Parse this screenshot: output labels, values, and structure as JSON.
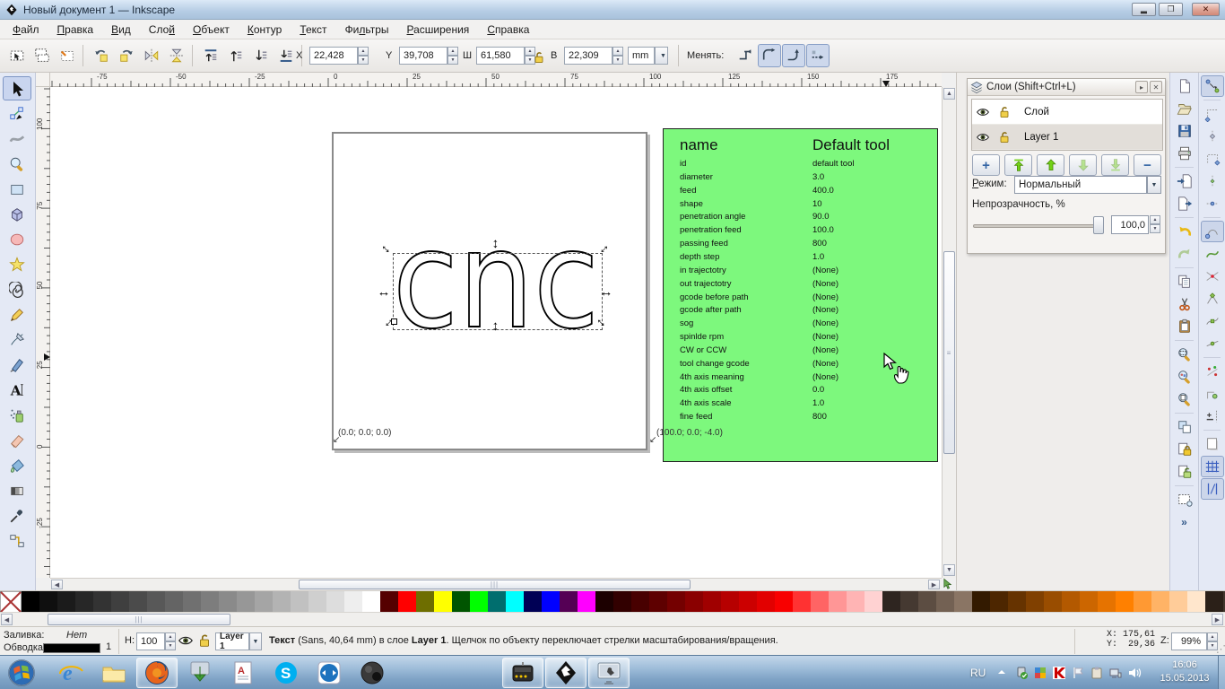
{
  "window": {
    "title": "Новый документ 1 — Inkscape"
  },
  "menu": {
    "items": [
      {
        "label": "Файл",
        "u": 0
      },
      {
        "label": "Правка",
        "u": 0
      },
      {
        "label": "Вид",
        "u": 0
      },
      {
        "label": "Слой",
        "u": 3
      },
      {
        "label": "Объект",
        "u": 0
      },
      {
        "label": "Контур",
        "u": 0
      },
      {
        "label": "Текст",
        "u": 0
      },
      {
        "label": "Фильтры",
        "u": 2
      },
      {
        "label": "Расширения",
        "u": 0
      },
      {
        "label": "Справка",
        "u": 0
      }
    ]
  },
  "tool_options": {
    "select_icons": [
      "select-all",
      "select-all-layers",
      "deselect"
    ],
    "transform_icons": [
      "rotate-ccw",
      "rotate-cw",
      "flip-horizontal",
      "flip-vertical"
    ],
    "z_icons": [
      "raise-to-top",
      "raise",
      "lower",
      "lower-to-bottom"
    ],
    "fields": [
      {
        "label": "X",
        "value": "22,428"
      },
      {
        "label": "Y",
        "value": "39,708"
      },
      {
        "label": "Ш",
        "value": "61,580"
      },
      {
        "label": "В",
        "value": "22,309"
      }
    ],
    "unit": "mm",
    "affect_label": "Менять:",
    "toggles": [
      {
        "name": "affect-stroke-toggle",
        "pressed": false
      },
      {
        "name": "affect-corners-toggle",
        "pressed": true
      },
      {
        "name": "affect-gradients-toggle",
        "pressed": true
      },
      {
        "name": "affect-patterns-toggle",
        "pressed": true
      }
    ]
  },
  "rulers": {
    "h_labels": [
      "-75",
      "-50",
      "-25",
      "0",
      "25",
      "50",
      "75",
      "100",
      "125",
      "150",
      "175"
    ],
    "v_labels": [
      "100",
      "75",
      "50",
      "25",
      "0",
      "-25"
    ]
  },
  "canvas": {
    "text_object": "cnc",
    "corner_left": "(0.0; 0.0; 0.0)",
    "corner_right": "(100.0; 0.0; -4.0)"
  },
  "tool_table": {
    "bg": "#7df87d",
    "name_header": "name",
    "value_header": "Default tool",
    "rows": [
      [
        "id",
        "default tool"
      ],
      [
        "diameter",
        "3.0"
      ],
      [
        "feed",
        "400.0"
      ],
      [
        "shape",
        "10"
      ],
      [
        "penetration angle",
        "90.0"
      ],
      [
        "penetration feed",
        "100.0"
      ],
      [
        "passing feed",
        "800"
      ],
      [
        "depth step",
        "1.0"
      ],
      [
        "in trajectotry",
        "(None)"
      ],
      [
        "out trajectotry",
        "(None)"
      ],
      [
        "gcode before path",
        "(None)"
      ],
      [
        "gcode after path",
        "(None)"
      ],
      [
        "sog",
        "(None)"
      ],
      [
        "spinlde rpm",
        "(None)"
      ],
      [
        "CW or CCW",
        "(None)"
      ],
      [
        "tool change gcode",
        "(None)"
      ],
      [
        "4th axis meaning",
        "(None)"
      ],
      [
        "4th axis offset",
        "0.0"
      ],
      [
        "4th axis scale",
        "1.0"
      ],
      [
        "fine feed",
        "800"
      ]
    ]
  },
  "toolbox": {
    "tools": [
      {
        "name": "selector-tool",
        "active": true
      },
      {
        "name": "node-tool"
      },
      {
        "name": "tweak-tool"
      },
      {
        "name": "zoom-tool"
      },
      {
        "name": "rectangle-tool"
      },
      {
        "name": "box3d-tool"
      },
      {
        "name": "ellipse-tool"
      },
      {
        "name": "star-tool"
      },
      {
        "name": "spiral-tool"
      },
      {
        "name": "pencil-tool"
      },
      {
        "name": "bezier-tool"
      },
      {
        "name": "calligraphy-tool"
      },
      {
        "name": "text-tool"
      },
      {
        "name": "spray-tool"
      },
      {
        "name": "eraser-tool"
      },
      {
        "name": "paint-bucket-tool"
      },
      {
        "name": "gradient-tool"
      },
      {
        "name": "dropper-tool"
      },
      {
        "name": "connector-tool"
      }
    ]
  },
  "commands_bar": {
    "items": [
      {
        "name": "new-document"
      },
      {
        "name": "open"
      },
      {
        "name": "save"
      },
      {
        "name": "print"
      },
      "sep",
      {
        "name": "import"
      },
      {
        "name": "export"
      },
      "sep",
      {
        "name": "undo"
      },
      {
        "name": "redo"
      },
      "sep",
      {
        "name": "copy"
      },
      {
        "name": "cut"
      },
      {
        "name": "paste"
      },
      "sep",
      {
        "name": "zoom-selection"
      },
      {
        "name": "zoom-drawing"
      },
      {
        "name": "zoom-page"
      },
      "sep",
      {
        "name": "duplicate"
      },
      {
        "name": "lock"
      },
      {
        "name": "unlock"
      },
      "sep",
      {
        "name": "selection-dialog"
      },
      {
        "name": "overflow"
      }
    ]
  },
  "snap_bar": {
    "items": [
      {
        "name": "snap-master",
        "pressed": true
      },
      "sep",
      {
        "name": "snap-bbox"
      },
      {
        "name": "snap-bbox-edges"
      },
      {
        "name": "snap-bbox-corners"
      },
      {
        "name": "snap-bbox-edge-midpoints"
      },
      {
        "name": "snap-bbox-centers"
      },
      "sep",
      {
        "name": "snap-nodes",
        "pressed": true
      },
      {
        "name": "snap-paths"
      },
      {
        "name": "snap-intersections"
      },
      {
        "name": "snap-cusp-nodes"
      },
      {
        "name": "snap-smooth-nodes"
      },
      {
        "name": "snap-midpoints"
      },
      "sep",
      {
        "name": "snap-others"
      },
      {
        "name": "snap-rotation-center"
      },
      {
        "name": "snap-text-baseline"
      },
      "sep",
      {
        "name": "snap-page-border"
      },
      {
        "name": "snap-grid",
        "pressed": true
      },
      {
        "name": "snap-guides",
        "pressed": true
      }
    ]
  },
  "layers_panel": {
    "title": "Слои (Shift+Ctrl+L)",
    "layers": [
      {
        "name": "Слой",
        "selected": false
      },
      {
        "name": "Layer 1",
        "selected": true
      }
    ],
    "buttons": [
      "add-layer",
      "raise-layer-to-top",
      "raise-layer",
      "lower-layer",
      "lower-layer-to-bottom",
      "delete-layer"
    ],
    "mode_label": "Режим:",
    "mode_value": "Нормальный",
    "opacity_label": "Непрозрачность, %",
    "opacity_value": "100,0"
  },
  "palette": {
    "colors": [
      "#000000",
      "#0f0f0f",
      "#1b1b1b",
      "#272727",
      "#333333",
      "#3f3f3f",
      "#4b4b4b",
      "#585858",
      "#646464",
      "#707070",
      "#7d7d7d",
      "#8a8a8a",
      "#979797",
      "#a5a5a5",
      "#b3b3b3",
      "#c1c1c1",
      "#cfcfcf",
      "#dddddd",
      "#eeeeee",
      "#ffffff",
      "#550000",
      "#ff0000",
      "#6e6e00",
      "#ffff00",
      "#005500",
      "#00ff00",
      "#006e6e",
      "#00ffff",
      "#000055",
      "#0000ff",
      "#550055",
      "#ff00ff",
      "#1c0000",
      "#320000",
      "#480000",
      "#5e0000",
      "#740000",
      "#8a0000",
      "#a00000",
      "#b60000",
      "#cc0000",
      "#e20000",
      "#f80000",
      "#ff3232",
      "#ff6464",
      "#ff9696",
      "#ffb4b4",
      "#ffd2d2",
      "#2e2520",
      "#453931",
      "#5c4d42",
      "#736153",
      "#8a7564",
      "#331a00",
      "#4d2600",
      "#663300",
      "#804000",
      "#994d00",
      "#b35900",
      "#cc6600",
      "#e67300",
      "#ff8000",
      "#ff9933",
      "#ffb366",
      "#ffcc99",
      "#ffe6cc",
      "#2b2018",
      "#41362c",
      "#574c40"
    ]
  },
  "status_bar": {
    "fill_label": "Заливка:",
    "fill_value": "Нет",
    "stroke_label": "Обводка:",
    "stroke_color": "#000000",
    "stroke_width": "1",
    "opacity_label": "Н:",
    "opacity_value": "100",
    "layer_value": "Layer 1",
    "message": [
      {
        "text": "Текст",
        "bold": true
      },
      {
        "text": " (Sans, 40,64 mm) в слое ",
        "bold": false
      },
      {
        "text": "Layer 1",
        "bold": true
      },
      {
        "text": ". Щелчок по объекту переключает стрелки масштабирования/вращения.",
        "bold": false
      }
    ],
    "x_label": "X:",
    "x_value": "175,61",
    "y_label": "Y:",
    "y_value": "29,36",
    "z_label": "Z:",
    "zoom_value": "99%"
  },
  "taskbar": {
    "apps": [
      {
        "name": "internet-explorer"
      },
      {
        "name": "file-explorer"
      },
      {
        "name": "firefox",
        "active": true
      },
      {
        "name": "download-manager"
      },
      {
        "name": "text-editor"
      },
      {
        "name": "skype"
      },
      {
        "name": "teamviewer"
      },
      {
        "name": "media-app"
      },
      {
        "name": "cnc-app",
        "active": true
      },
      {
        "name": "inkscape",
        "active": true
      },
      {
        "name": "remote-viewer",
        "active": true
      }
    ],
    "tray": {
      "lang": "RU",
      "icons": [
        "tray-expand-arrow",
        "usb-icon",
        "update-icon",
        "antivirus-icon",
        "flag-icon",
        "clipboard-icon",
        "network-icon",
        "volume-icon"
      ],
      "time": "16:06",
      "date": "15.05.2013"
    }
  }
}
